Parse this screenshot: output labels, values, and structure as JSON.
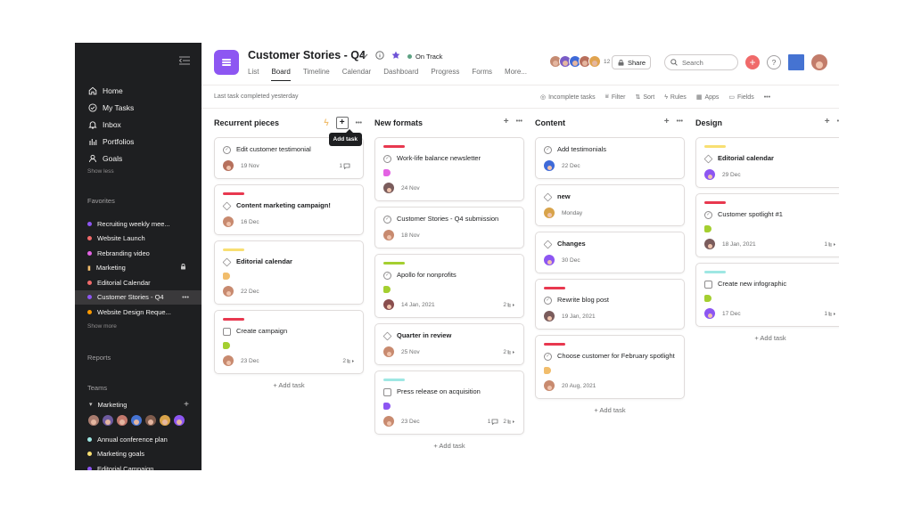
{
  "sidebar": {
    "collapse_icon": "collapse-sidebar-icon",
    "nav": [
      {
        "label": "Home",
        "icon": "home-icon"
      },
      {
        "label": "My Tasks",
        "icon": "check-circle-icon"
      },
      {
        "label": "Inbox",
        "icon": "bell-icon"
      },
      {
        "label": "Portfolios",
        "icon": "bar-chart-icon"
      },
      {
        "label": "Goals",
        "icon": "person-icon"
      }
    ],
    "show_less": "Show less",
    "favorites_title": "Favorites",
    "favorites": [
      {
        "label": "Recruiting weekly mee...",
        "color": "#8d56f2"
      },
      {
        "label": "Website Launch",
        "color": "#f06a6a"
      },
      {
        "label": "Rebranding video",
        "color": "#e362e3"
      },
      {
        "label": "Marketing",
        "color": "#f1bd6c"
      },
      {
        "label": "Editorial Calendar",
        "color": "#f06a6a"
      },
      {
        "label": "Customer Stories - Q4",
        "color": "#8d56f2"
      },
      {
        "label": "Website Design Reque...",
        "color": "#fd9a00"
      }
    ],
    "show_more": "Show more",
    "reports": "Reports",
    "teams_title": "Teams",
    "team_name": "Marketing",
    "team_projects": [
      {
        "label": "Annual conference plan",
        "color": "#9ee7e3"
      },
      {
        "label": "Marketing goals",
        "color": "#f8df72"
      },
      {
        "label": "Editorial Campaign",
        "color": "#8d56f2"
      }
    ],
    "member_colors": [
      "#a87b6e",
      "#6d5a9e",
      "#c2786c",
      "#4573d2",
      "#7f5b4c",
      "#d8a34a",
      "#8d56f2"
    ]
  },
  "header": {
    "project_title": "Customer Stories - Q4",
    "status": "On Track",
    "tabs": [
      "List",
      "Board",
      "Timeline",
      "Calendar",
      "Dashboard",
      "Progress",
      "Forms",
      "More..."
    ],
    "active_tab": "Board",
    "member_colors": [
      "#c58b72",
      "#7a5cc6",
      "#3f6ad8",
      "#b86f5c",
      "#e0a34f"
    ],
    "member_count": "12",
    "share": "Share",
    "search_placeholder": "Search"
  },
  "toolbar": {
    "last_task": "Last task completed yesterday",
    "incomplete": "Incomplete tasks",
    "filter": "Filter",
    "sort": "Sort",
    "rules": "Rules",
    "apps": "Apps",
    "fields": "Fields"
  },
  "board": {
    "add_task": "+ Add task",
    "tooltip": "Add task",
    "columns": [
      {
        "title": "Recurrent pieces",
        "cards": [
          {
            "title": "Edit customer testimonial",
            "type": "check",
            "date": "19 Nov",
            "comments": "1",
            "avatar": "#b6705c"
          },
          {
            "title": "Content marketing campaign!",
            "type": "milestone",
            "stripe": "#e8384f",
            "date": "16 Dec",
            "avatar": "#c88a6f"
          },
          {
            "title": "Editorial calendar",
            "type": "milestone",
            "stripe": "#f8df72",
            "tag": "#f1bd6c",
            "date": "22 Dec",
            "avatar": "#c88a6f"
          },
          {
            "title": "Create campaign",
            "type": "approval",
            "stripe": "#e8384f",
            "tag": "#a4cf30",
            "date": "23 Dec",
            "subtasks": "2",
            "avatar": "#c88a6f"
          }
        ]
      },
      {
        "title": "New formats",
        "cards": [
          {
            "title": "Work-life balance newsletter",
            "type": "check",
            "stripe": "#e8384f",
            "tag": "#e362e3",
            "date": "24 Nov",
            "avatar": "#7a5c5c"
          },
          {
            "title": "Customer Stories - Q4 submission",
            "type": "check",
            "date": "18 Nov",
            "avatar": "#c88a6f"
          },
          {
            "title": "Apollo for nonprofits",
            "type": "check",
            "stripe": "#a4cf30",
            "tag": "#a4cf30",
            "date": "14 Jan, 2021",
            "subtasks": "2",
            "avatar": "#8a4e4e"
          },
          {
            "title": "Quarter in review",
            "type": "milestone",
            "date": "25 Nov",
            "subtasks": "2",
            "avatar": "#c88a6f"
          },
          {
            "title": "Press release on acquisition",
            "type": "approval",
            "stripe": "#9ee7e3",
            "tag": "#8d56f2",
            "date": "23 Dec",
            "comments": "1",
            "subtasks": "2",
            "avatar": "#c88a6f"
          }
        ]
      },
      {
        "title": "Content",
        "cards": [
          {
            "title": "Add testimonials",
            "type": "check",
            "date": "22 Dec",
            "avatar": "#3f6ad8"
          },
          {
            "title": "new",
            "type": "milestone",
            "date": "Monday",
            "avatar": "#d8a34a"
          },
          {
            "title": "Changes",
            "type": "milestone",
            "date": "30 Dec",
            "avatar": "#8d56f2"
          },
          {
            "title": "Rewrite blog post",
            "type": "check",
            "stripe": "#e8384f",
            "date": "19 Jan, 2021",
            "avatar": "#7a5c5c"
          },
          {
            "title": "Choose customer for February spotlight",
            "type": "check",
            "stripe": "#e8384f",
            "tag": "#f1bd6c",
            "date": "20 Aug, 2021",
            "avatar": "#c88a6f"
          }
        ]
      },
      {
        "title": "Design",
        "cards": [
          {
            "title": "Editorial calendar",
            "type": "milestone",
            "stripe": "#f8df72",
            "date": "29 Dec",
            "avatar": "#8d56f2"
          },
          {
            "title": "Customer spotlight #1",
            "type": "check",
            "stripe": "#e8384f",
            "tag": "#a4cf30",
            "date": "18 Jan, 2021",
            "subtasks": "1",
            "avatar": "#7a5c5c"
          },
          {
            "title": "Create new infographic",
            "type": "approval",
            "stripe": "#9ee7e3",
            "tag": "#a4cf30",
            "date": "17 Dec",
            "subtasks": "1",
            "avatar": "#8d56f2"
          }
        ]
      }
    ]
  }
}
